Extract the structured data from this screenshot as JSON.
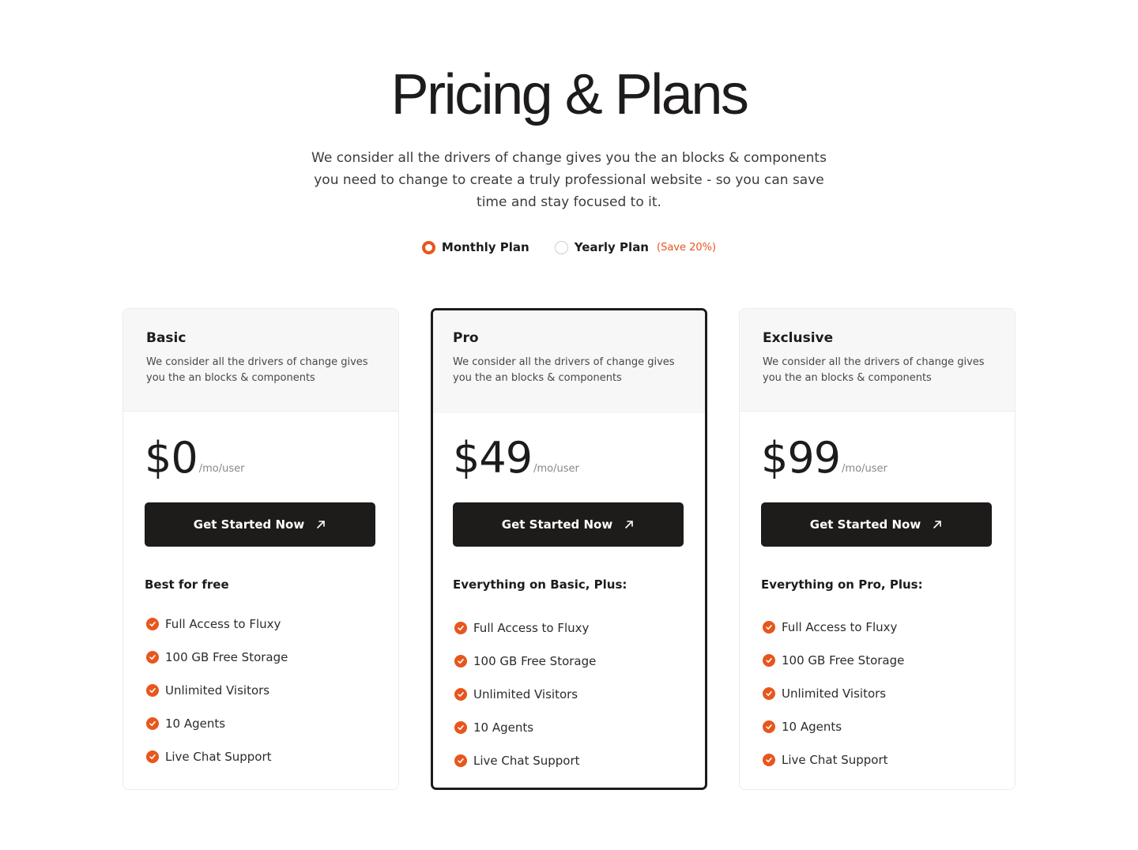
{
  "header": {
    "title": "Pricing & Plans",
    "subtitle": "We consider all the drivers of change gives you the an blocks & components you need to change to create a truly professional website - so you can save time and stay focused to it."
  },
  "billing_toggle": {
    "monthly_label": "Monthly Plan",
    "yearly_label": "Yearly Plan",
    "yearly_badge": "(Save 20%)",
    "selected": "monthly"
  },
  "plans": [
    {
      "name": "Basic",
      "description": "We consider all the drivers of change gives you the an blocks & components",
      "price": "$0",
      "period": "/mo/user",
      "cta": "Get Started Now",
      "features_heading": "Best for free",
      "features": [
        "Full Access to Fluxy",
        "100 GB Free Storage",
        "Unlimited Visitors",
        "10 Agents",
        "Live Chat Support"
      ]
    },
    {
      "name": "Pro",
      "description": "We consider all the drivers of change gives you the an blocks & components",
      "price": "$49",
      "period": "/mo/user",
      "cta": "Get Started Now",
      "features_heading": "Everything on Basic, Plus:",
      "features": [
        "Full Access to Fluxy",
        "100 GB Free Storage",
        "Unlimited Visitors",
        "10 Agents",
        "Live Chat Support"
      ]
    },
    {
      "name": "Exclusive",
      "description": "We consider all the drivers of change gives you the an blocks & components",
      "price": "$99",
      "period": "/mo/user",
      "cta": "Get Started Now",
      "features_heading": "Everything on Pro, Plus:",
      "features": [
        "Full Access to Fluxy",
        "100 GB Free Storage",
        "Unlimited Visitors",
        "10 Agents",
        "Live Chat Support"
      ]
    }
  ],
  "colors": {
    "accent": "#e8561d",
    "dark": "#1e1b1b",
    "card_head_bg": "#f7f7f7"
  },
  "icons": {
    "cta": "arrow-up-right-icon",
    "feature": "check-circle-icon"
  }
}
